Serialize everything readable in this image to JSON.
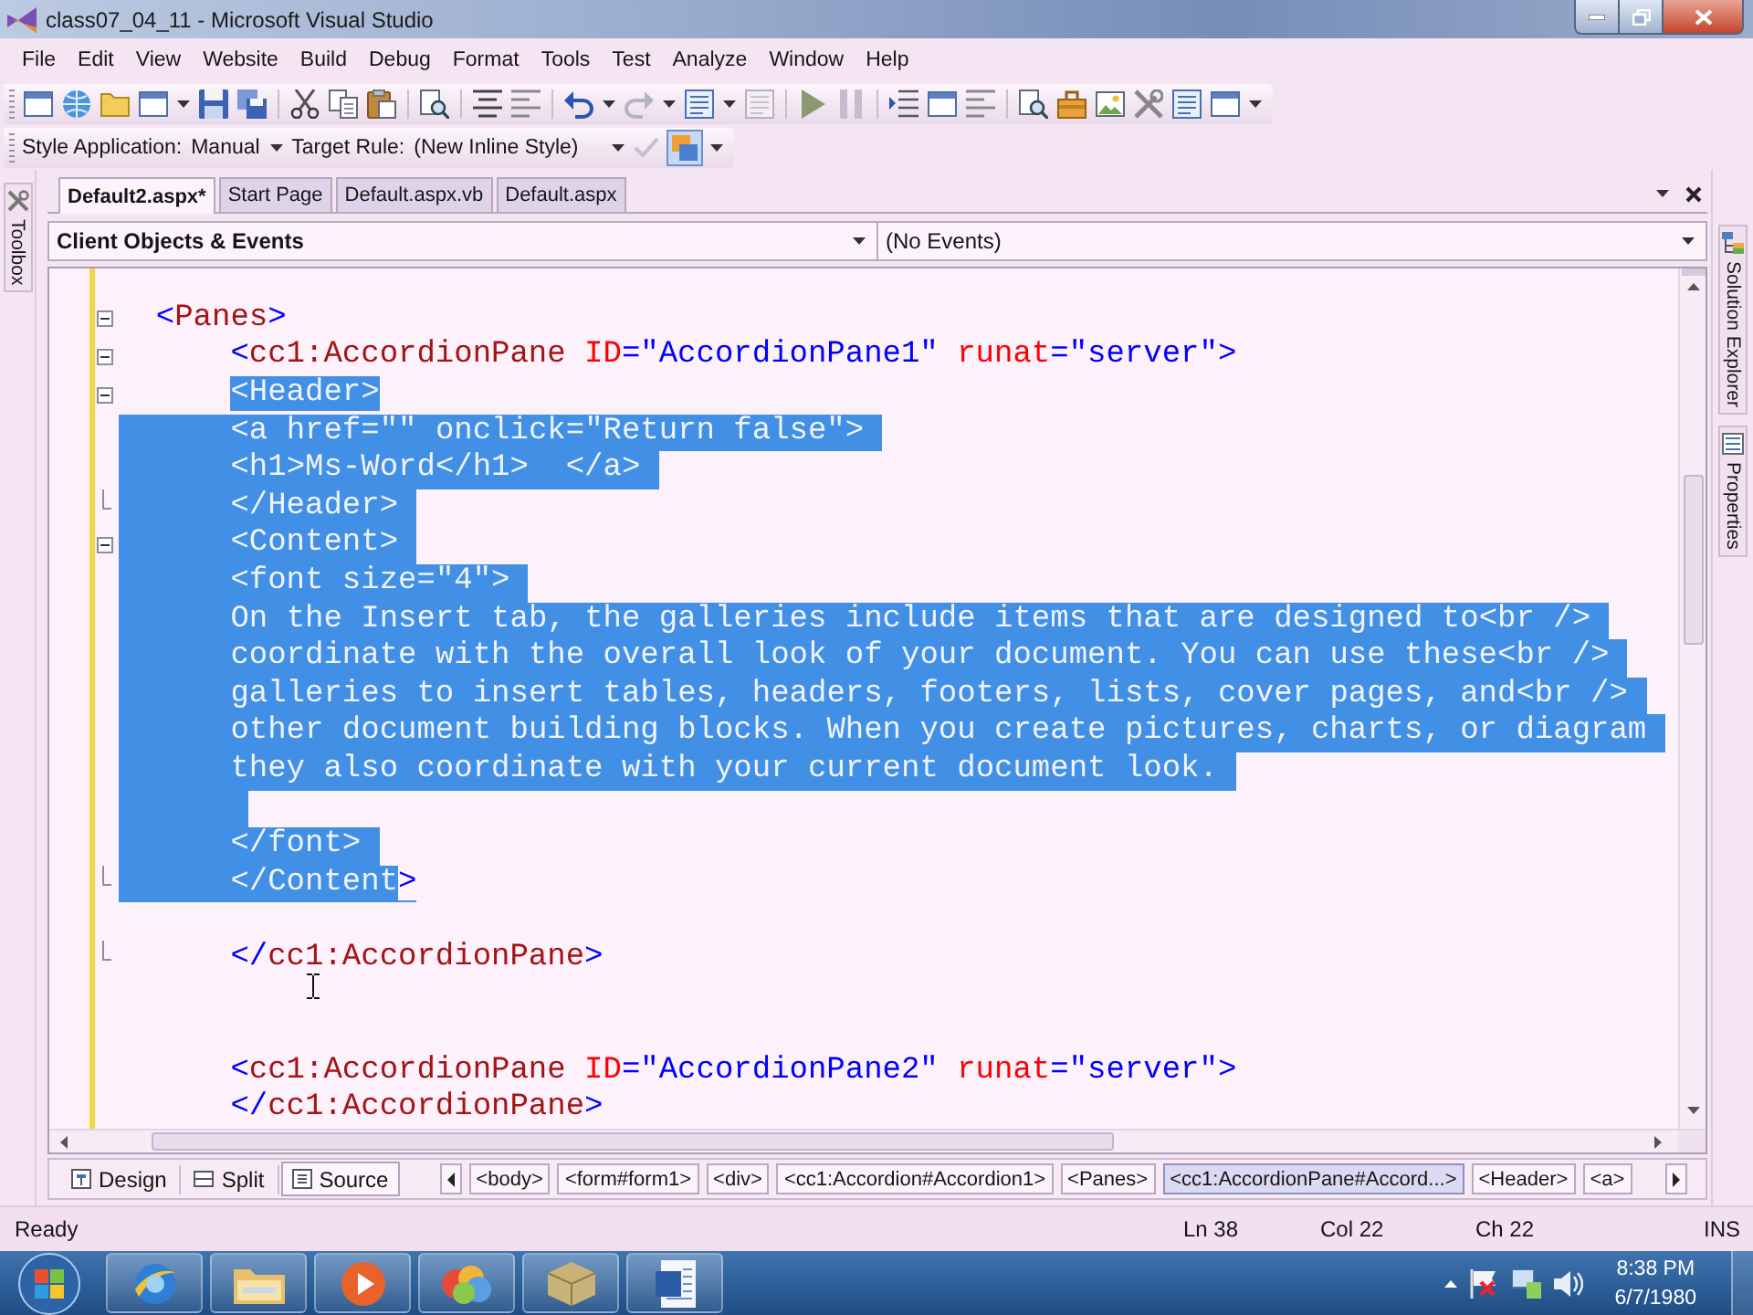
{
  "window": {
    "title": "class07_04_11 - Microsoft Visual Studio"
  },
  "menu": [
    "File",
    "Edit",
    "View",
    "Website",
    "Build",
    "Debug",
    "Format",
    "Tools",
    "Test",
    "Analyze",
    "Window",
    "Help"
  ],
  "style_toolbar": {
    "style_application_label": "Style Application:",
    "style_application": "Manual",
    "target_rule_label": "Target Rule:",
    "target_rule": "(New Inline Style)",
    "style_tool_selected": true
  },
  "left_panels": [
    "Toolbox"
  ],
  "right_panels": [
    "Solution Explorer",
    "Properties"
  ],
  "document_tabs": [
    {
      "label": "Default2.aspx*",
      "selected": true
    },
    {
      "label": "Start Page",
      "selected": false
    },
    {
      "label": "Default.aspx.vb",
      "selected": false
    },
    {
      "label": "Default.aspx",
      "selected": false
    }
  ],
  "object_bar": {
    "objects": "Client Objects & Events",
    "events": "(No Events)"
  },
  "code_lines": [
    {
      "kind": "fold_start",
      "selected": false,
      "expanded": true,
      "parts": [
        {
          "text": "<Panes>",
          "selected": false
        }
      ],
      "children": [
        {
          "kind": "fold_start",
          "selected": false,
          "expanded": true,
          "parts": [
            {
              "text": "<cc1:AccordionPane ID=\"AccordionPane1\" runat=\"server\">",
              "selected": false
            }
          ]
        },
        {
          "kind": "fold_start",
          "selected": false,
          "expanded": true,
          "parts": [
            {
              "text": "<Header>",
              "selected": true
            }
          ]
        },
        {
          "kind": "plain",
          "selected": true,
          "parts": [
            {
              "text": "<a href=\"\" onclick=\"Return false\">",
              "selected": true
            }
          ]
        },
        {
          "kind": "plain",
          "selected": true,
          "parts": [
            {
              "text": "<h1>Ms-Word</h1>  </a>",
              "selected": true
            }
          ]
        },
        {
          "kind": "fold_end",
          "selected": true,
          "parts": [
            {
              "text": "</Header>",
              "selected": true
            }
          ]
        },
        {
          "kind": "fold_start",
          "selected": true,
          "expanded": true,
          "parts": [
            {
              "text": "<Content>",
              "selected": true
            }
          ]
        },
        {
          "kind": "plain",
          "selected": true,
          "parts": [
            {
              "text": "<font size=\"4\">",
              "selected": true
            }
          ]
        },
        {
          "kind": "plain",
          "selected": true,
          "parts": [
            {
              "text": "On the Insert tab, the galleries include items that are designed to<br />",
              "selected": true
            }
          ]
        },
        {
          "kind": "plain",
          "selected": true,
          "parts": [
            {
              "text": "coordinate with the overall look of your document. You can use these<br />",
              "selected": true
            }
          ]
        },
        {
          "kind": "plain",
          "selected": true,
          "parts": [
            {
              "text": "galleries to insert tables, headers, footers, lists, cover pages, and<br />",
              "selected": true
            }
          ]
        },
        {
          "kind": "plain",
          "selected": true,
          "parts": [
            {
              "text": "other document building blocks. When you create pictures, charts, or diagram",
              "selected": true
            }
          ]
        },
        {
          "kind": "plain",
          "selected": true,
          "parts": [
            {
              "text": "they also coordinate with your current document look.",
              "selected": true
            }
          ]
        },
        {
          "kind": "plain",
          "selected": true
        },
        {
          "kind": "plain",
          "selected": true,
          "parts": [
            {
              "text": "</font>",
              "selected": true
            }
          ]
        },
        {
          "kind": "fold_end",
          "selected": true,
          "parts": [
            {
              "text": "</Content",
              "selected": true
            },
            {
              "text": ">",
              "selected": false
            }
          ]
        },
        {
          "kind": "plain",
          "selected": false
        },
        {
          "kind": "fold_end",
          "selected": false,
          "parts": [
            {
              "text": "</cc1:AccordionPane>",
              "selected": false
            }
          ]
        },
        {
          "kind": "plain",
          "selected": false
        },
        {
          "kind": "plain",
          "selected": false
        },
        {
          "kind": "plain",
          "selected": false,
          "parts": [
            {
              "text": "<cc1:AccordionPane ID=\"AccordionPane2\" runat=\"server\">",
              "selected": false
            }
          ]
        },
        {
          "kind": "plain",
          "selected": false,
          "parts": [
            {
              "text": "</cc1:AccordionPane>",
              "selected": false
            }
          ]
        }
      ]
    }
  ],
  "view_tabs": [
    {
      "label": "Design",
      "selected": false
    },
    {
      "label": "Split",
      "selected": false
    },
    {
      "label": "Source",
      "selected": true
    }
  ],
  "breadcrumbs": [
    {
      "label": "<body>",
      "selected": false
    },
    {
      "label": "<form#form1>",
      "selected": false
    },
    {
      "label": "<div>",
      "selected": false
    },
    {
      "label": "<cc1:Accordion#Accordion1>",
      "selected": false
    },
    {
      "label": "<Panes>",
      "selected": false
    },
    {
      "label": "<cc1:AccordionPane#Accord...>",
      "selected": true
    },
    {
      "label": "<Header>",
      "selected": false
    },
    {
      "label": "<a>",
      "selected": false
    }
  ],
  "status_bar": {
    "message": "Ready",
    "line": "Ln 38",
    "column": "Col 22",
    "character": "Ch 22",
    "mode": "INS"
  },
  "taskbar": {
    "time": "8:38 PM",
    "date": "6/7/1980"
  }
}
